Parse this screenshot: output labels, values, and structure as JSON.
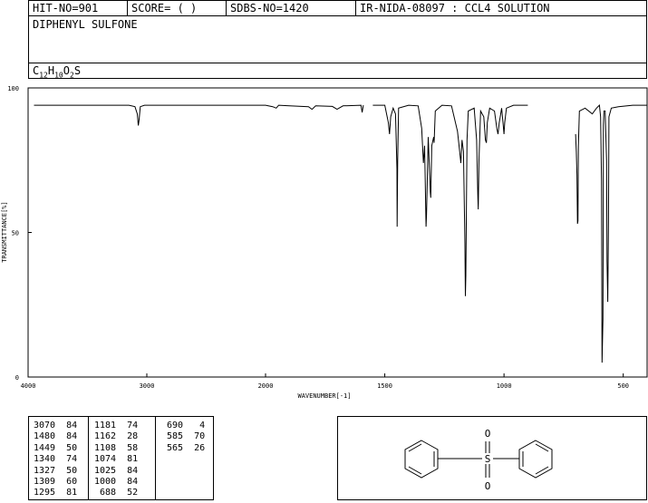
{
  "header": {
    "hit_no": "HIT-NO=901",
    "score": "SCORE=  (  )",
    "sdbs_no": "SDBS-NO=1420",
    "ir_code": "IR-NIDA-08097 : CCL4 SOLUTION",
    "compound_name": "DIPHENYL SULFONE",
    "formula": {
      "c": "C",
      "c_n": "12",
      "h": "H",
      "h_n": "10",
      "o": "O",
      "o_n": "2",
      "s": "S"
    }
  },
  "chart_data": {
    "type": "line",
    "xlabel": "WAVENUMBER[-1]",
    "ylabel": "TRANSMITTANCE[%]",
    "xlim": [
      4000,
      400
    ],
    "ylim": [
      0,
      100
    ],
    "x_ticks": [
      "4000",
      "3000",
      "2000",
      "1500",
      "1000",
      "500"
    ],
    "y_ticks": [
      "100",
      "50",
      "0"
    ],
    "series": [
      {
        "segments": [
          [
            [
              3950,
              94
            ],
            [
              3150,
              94
            ],
            [
              3100,
              93.5
            ],
            [
              3080,
              91
            ],
            [
              3072,
              87
            ],
            [
              3065,
              89
            ],
            [
              3055,
              93.5
            ],
            [
              3020,
              94
            ],
            [
              2500,
              94
            ],
            [
              2000,
              94
            ],
            [
              1970,
              93.5
            ],
            [
              1955,
              93
            ],
            [
              1945,
              94
            ],
            [
              1900,
              93.8
            ],
            [
              1820,
              93.5
            ],
            [
              1805,
              92.6
            ],
            [
              1790,
              93.8
            ],
            [
              1720,
              93.6
            ],
            [
              1700,
              92.6
            ],
            [
              1675,
              93.8
            ],
            [
              1600,
              94
            ],
            [
              1595,
              91.5
            ],
            [
              1590,
              94
            ]
          ],
          [
            [
              1550,
              94
            ],
            [
              1500,
              94
            ],
            [
              1485,
              88
            ],
            [
              1480,
              84
            ],
            [
              1475,
              90
            ],
            [
              1465,
              93
            ],
            [
              1455,
              91
            ],
            [
              1449,
              72
            ],
            [
              1448,
              52
            ],
            [
              1446,
              75
            ],
            [
              1442,
              93
            ],
            [
              1400,
              94
            ],
            [
              1360,
              93.8
            ],
            [
              1345,
              86
            ],
            [
              1340,
              77
            ],
            [
              1338,
              74
            ],
            [
              1333,
              80
            ],
            [
              1327,
              52
            ],
            [
              1325,
              56
            ],
            [
              1318,
              83
            ],
            [
              1309,
              64
            ],
            [
              1307,
              62
            ],
            [
              1303,
              80
            ],
            [
              1295,
              83
            ],
            [
              1293,
              81
            ],
            [
              1288,
              92
            ],
            [
              1260,
              94
            ],
            [
              1220,
              93.8
            ],
            [
              1195,
              85
            ],
            [
              1186,
              78
            ],
            [
              1181,
              74
            ],
            [
              1176,
              82
            ],
            [
              1170,
              78
            ],
            [
              1164,
              46
            ],
            [
              1162,
              28
            ],
            [
              1160,
              35
            ],
            [
              1155,
              82
            ],
            [
              1150,
              92
            ],
            [
              1125,
              93
            ],
            [
              1115,
              82
            ],
            [
              1110,
              63
            ],
            [
              1108,
              58
            ],
            [
              1105,
              75
            ],
            [
              1098,
              92
            ],
            [
              1085,
              90
            ],
            [
              1078,
              82
            ],
            [
              1074,
              81
            ],
            [
              1070,
              88
            ],
            [
              1060,
              93
            ],
            [
              1040,
              92
            ],
            [
              1030,
              86
            ],
            [
              1025,
              84
            ],
            [
              1020,
              88
            ],
            [
              1010,
              93
            ],
            [
              1003,
              87
            ],
            [
              1000,
              84
            ],
            [
              997,
              88
            ],
            [
              990,
              93
            ],
            [
              960,
              94
            ],
            [
              900,
              94
            ]
          ],
          [
            [
              700,
              84
            ],
            [
              697,
              78
            ],
            [
              694,
              70
            ],
            [
              692,
              53
            ],
            [
              690,
              54
            ],
            [
              688,
              80
            ],
            [
              684,
              92
            ],
            [
              660,
              93
            ],
            [
              630,
              91
            ],
            [
              612,
              93
            ],
            [
              600,
              94
            ],
            [
              595,
              90
            ],
            [
              591,
              68
            ],
            [
              589,
              5
            ],
            [
              585,
              20
            ],
            [
              583,
              87
            ],
            [
              581,
              92
            ],
            [
              576,
              92
            ],
            [
              570,
              75
            ],
            [
              568,
              40
            ],
            [
              565,
              26
            ],
            [
              562,
              54
            ],
            [
              560,
              90
            ],
            [
              550,
              93
            ],
            [
              520,
              93.5
            ],
            [
              460,
              94
            ],
            [
              400,
              94
            ]
          ]
        ]
      }
    ],
    "peaks": [
      {
        "x": 3070,
        "t": 84
      },
      {
        "x": 1480,
        "t": 84
      },
      {
        "x": 1449,
        "t": 50
      },
      {
        "x": 1340,
        "t": 74
      },
      {
        "x": 1327,
        "t": 50
      },
      {
        "x": 1309,
        "t": 60
      },
      {
        "x": 1295,
        "t": 81
      },
      {
        "x": 1181,
        "t": 74
      },
      {
        "x": 1162,
        "t": 28
      },
      {
        "x": 1108,
        "t": 58
      },
      {
        "x": 1074,
        "t": 81
      },
      {
        "x": 1025,
        "t": 84
      },
      {
        "x": 1000,
        "t": 84
      },
      {
        "x": 688,
        "t": 52
      },
      {
        "x": 690,
        "t": 4
      },
      {
        "x": 585,
        "t": 70
      },
      {
        "x": 565,
        "t": 26
      }
    ]
  },
  "peak_table": [
    [
      [
        "3070",
        "84"
      ],
      [
        "1480",
        "84"
      ],
      [
        "1449",
        "50"
      ],
      [
        "1340",
        "74"
      ],
      [
        "1327",
        "50"
      ],
      [
        "1309",
        "60"
      ],
      [
        "1295",
        "81"
      ]
    ],
    [
      [
        "1181",
        "74"
      ],
      [
        "1162",
        "28"
      ],
      [
        "1108",
        "58"
      ],
      [
        "1074",
        "81"
      ],
      [
        "1025",
        "84"
      ],
      [
        "1000",
        "84"
      ],
      [
        "688",
        "52"
      ]
    ],
    [
      [
        "690",
        "4"
      ],
      [
        "585",
        "70"
      ],
      [
        "565",
        "26"
      ]
    ]
  ],
  "structure": {
    "atom_s": "S",
    "atom_o_top": "O",
    "atom_o_bottom": "O"
  }
}
